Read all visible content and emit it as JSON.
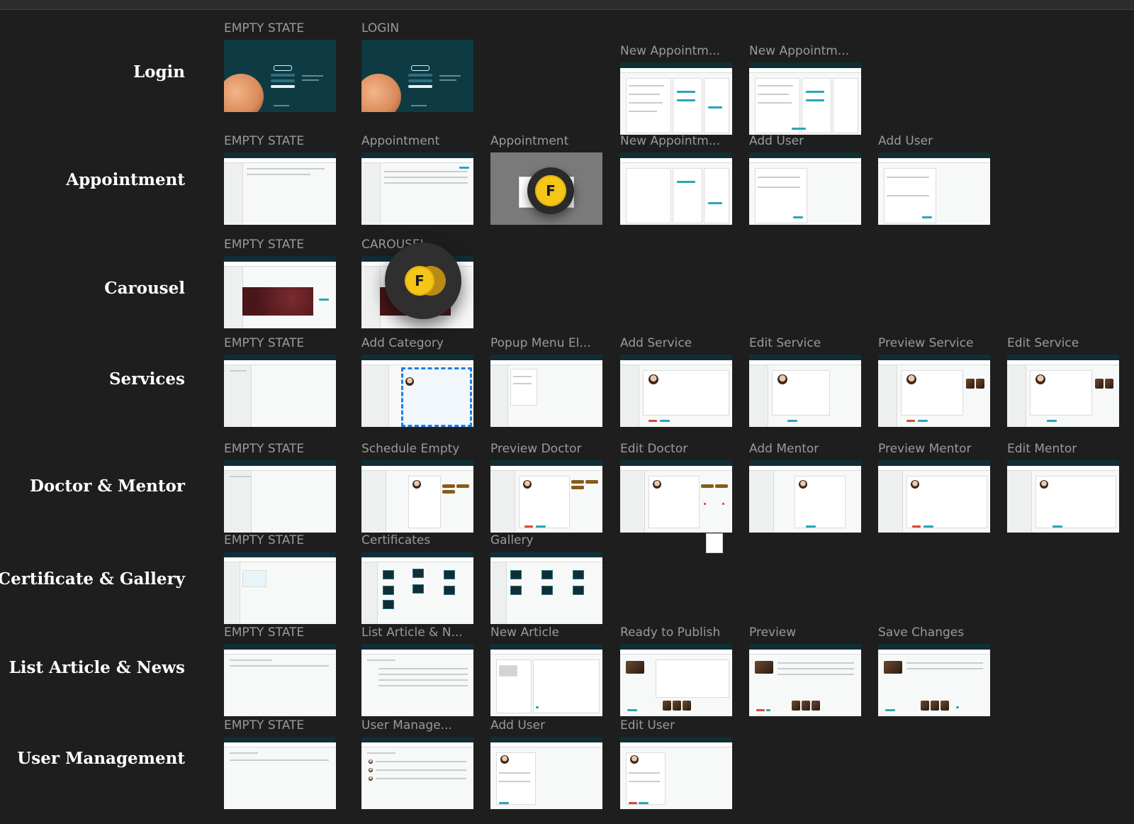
{
  "rows": [
    {
      "label": "Login"
    },
    {
      "label": "Appointment"
    },
    {
      "label": "Carousel"
    },
    {
      "label": "Services"
    },
    {
      "label": "Doctor & Mentor"
    },
    {
      "label": "Certificate & Gallery"
    },
    {
      "label": "List Article & News"
    },
    {
      "label": "User Management"
    }
  ],
  "login": [
    "EMPTY STATE",
    "LOGIN",
    "New Appointm...",
    "New Appointm..."
  ],
  "appointment": [
    "EMPTY STATE",
    "Appointment",
    "Appointment",
    "New Appointm...",
    "Add User",
    "Add User"
  ],
  "carousel": [
    "EMPTY STATE",
    "CAROUSEL"
  ],
  "services": [
    "EMPTY STATE",
    "Add Category",
    "Popup Menu El...",
    "Add Service",
    "Edit Service",
    "Preview Service",
    "Edit Service"
  ],
  "doctor": [
    "EMPTY STATE",
    "Schedule Empty",
    "Preview Doctor",
    "Edit Doctor",
    "Add Mentor",
    "Preview Mentor",
    "Edit Mentor"
  ],
  "certificate": [
    "EMPTY STATE",
    "Certificates",
    "Gallery"
  ],
  "article": [
    "EMPTY STATE",
    "List Article & N...",
    "New Article",
    "Ready to Publish",
    "Preview",
    "Save Changes"
  ],
  "users": [
    "EMPTY STATE",
    "User Manage...",
    "Add User",
    "Edit User"
  ],
  "avatars": {
    "small": "F",
    "big": "F"
  },
  "colors": {
    "background": "#1e1e1e",
    "frame_title": "#9a9a9a",
    "row_label": "#ffffff",
    "avatar": "#f5c518",
    "app_header": "#0f2e36",
    "accent": "#2aa6b8"
  }
}
